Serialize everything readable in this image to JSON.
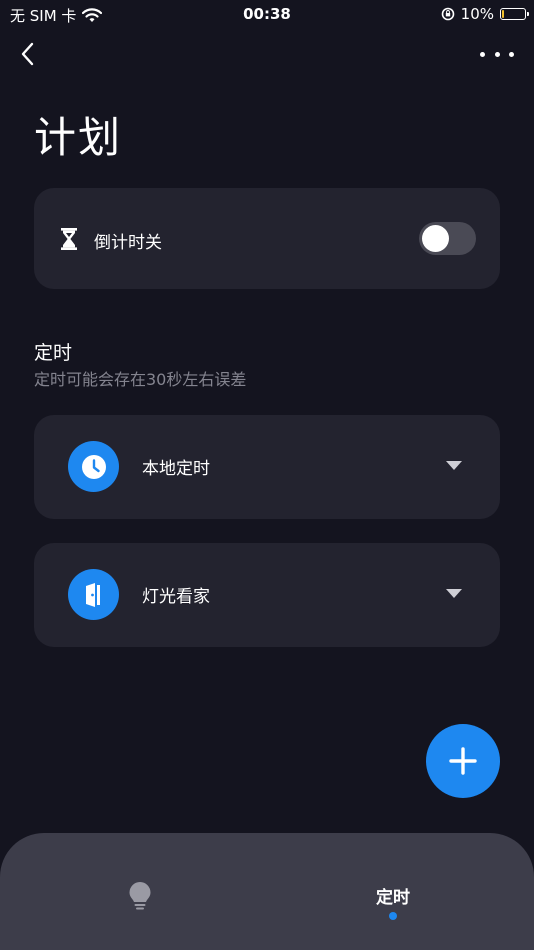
{
  "status_bar": {
    "carrier": "无 SIM 卡",
    "time": "00:38",
    "battery_percent": "10%",
    "battery_level": 0.1,
    "battery_color": "#f2c12e"
  },
  "nav": {
    "back_icon": "chevron-left-icon",
    "more_icon": "more-horizontal-icon"
  },
  "page": {
    "title": "计划"
  },
  "countdown": {
    "icon": "hourglass-icon",
    "label": "倒计时关",
    "enabled": false
  },
  "schedule": {
    "title": "定时",
    "subtitle": "定时可能会存在30秒左右误差",
    "items": [
      {
        "icon": "clock-icon",
        "label": "本地定时"
      },
      {
        "icon": "door-icon",
        "label": "灯光看家"
      }
    ]
  },
  "fab": {
    "icon": "plus-icon"
  },
  "tab_bar": {
    "tabs": [
      {
        "icon": "bulb-icon",
        "label": ""
      },
      {
        "label": "定时",
        "active": true
      }
    ]
  },
  "colors": {
    "background": "#14141f",
    "card": "#23232f",
    "accent": "#1e88f0",
    "tab_bar": "#3d3d4a",
    "secondary_text": "#84848f"
  }
}
